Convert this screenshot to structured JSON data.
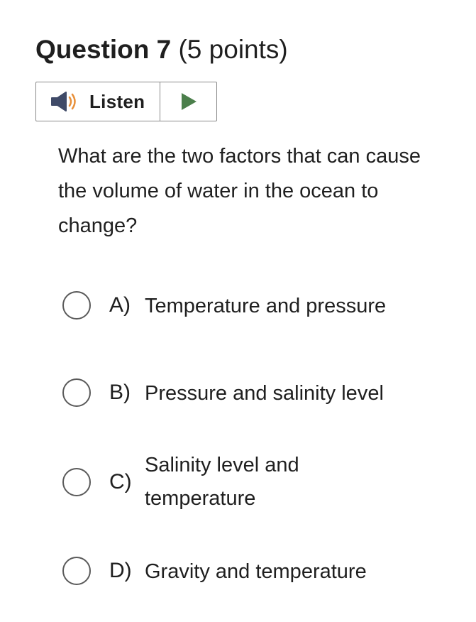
{
  "question": {
    "label": "Question 7",
    "points": "(5 points)"
  },
  "listen": {
    "label": "Listen",
    "speaker_icon": "speaker-icon",
    "play_icon": "play-icon",
    "colors": {
      "speaker_body": "#3f4a68",
      "speaker_waves": "#e8903a",
      "play": "#4b7f4b"
    }
  },
  "prompt": {
    "text": "What are the two factors that can cause the volume of water in the ocean to change?"
  },
  "choices": [
    {
      "letter": "A)",
      "text": "Temperature and pressure"
    },
    {
      "letter": "B)",
      "text": "Pressure and salinity level"
    },
    {
      "letter": "C)",
      "text": "Salinity level and temperature"
    },
    {
      "letter": "D)",
      "text": "Gravity and temperature"
    }
  ]
}
